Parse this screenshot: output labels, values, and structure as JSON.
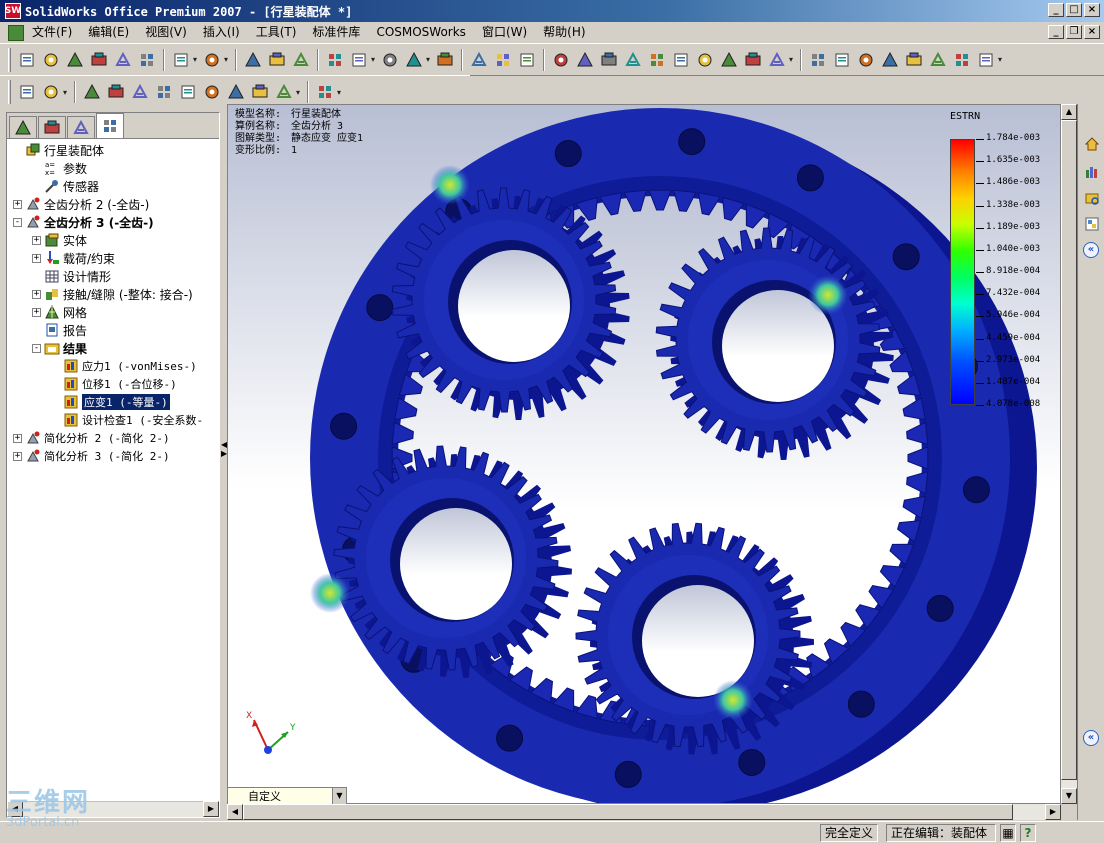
{
  "window": {
    "title": "SolidWorks Office Premium 2007 - [行星装配体 *]",
    "app_icon_text": "SW",
    "controls": {
      "minimize": "_",
      "maximize": "□",
      "close": "×",
      "restore": "❐"
    }
  },
  "menubar": {
    "items": [
      "文件(F)",
      "编辑(E)",
      "视图(V)",
      "插入(I)",
      "工具(T)",
      "标准件库",
      "COSMOSWorks",
      "窗口(W)",
      "帮助(H)"
    ]
  },
  "toolbar1": {
    "icons": [
      "new-icon",
      "open-icon",
      "save-icon",
      "print-preview-icon",
      "options-icon",
      "print-icon",
      "undo-icon",
      "redo-icon",
      "select-icon",
      "smart-select-icon",
      "traffic-light-icon",
      "grid-icon",
      "sketch-icon",
      "assembly-icon",
      "box-icon",
      "help-icon",
      "section-icon",
      "measure-icon",
      "target-icon",
      "mirror-icon",
      "zoom-to-fit-icon",
      "zoom-area-icon",
      "zoom-in-out-icon",
      "zoom-selection-icon",
      "zoom-icon",
      "rotate-icon",
      "pan-icon",
      "roll-icon",
      "view-orientation-icon",
      "wireframe-icon",
      "hidden-lines-icon",
      "hidden-removed-icon",
      "shaded-edges-icon",
      "shaded-icon",
      "shadows-icon",
      "perspective-icon",
      "realview-icon"
    ]
  },
  "toolbar2": {
    "icons": [
      "study-icon",
      "mesh-icon",
      "run-icon",
      "results-icon",
      "plot-icon",
      "clip-icon",
      "probe-icon",
      "animate-icon",
      "design-check-icon",
      "report-icon",
      "wizard-icon",
      "settings-icon"
    ]
  },
  "left_tabs": [
    "feature-manager-tab",
    "property-manager-tab",
    "configuration-manager-tab",
    "cosmos-manager-tab"
  ],
  "tree": [
    {
      "label": "行星装配体",
      "indent": 0,
      "expander": "",
      "icon": "assembly-icon",
      "bold": false,
      "mono": false
    },
    {
      "label": "参数",
      "indent": 1,
      "expander": "",
      "icon": "parameters-icon",
      "bold": false,
      "mono": false
    },
    {
      "label": "传感器",
      "indent": 1,
      "expander": "",
      "icon": "sensor-icon",
      "bold": false,
      "mono": false
    },
    {
      "label": "全齿分析 2 (-全齿-)",
      "indent": 0,
      "expander": "+",
      "icon": "study-icon",
      "bold": false,
      "mono": false
    },
    {
      "label": "全齿分析 3 (-全齿-)",
      "indent": 0,
      "expander": "-",
      "icon": "study-icon",
      "bold": true,
      "mono": false
    },
    {
      "label": "实体",
      "indent": 1,
      "expander": "+",
      "icon": "solids-icon",
      "bold": false,
      "mono": false
    },
    {
      "label": "载荷/约束",
      "indent": 1,
      "expander": "+",
      "icon": "load-restraint-icon",
      "bold": false,
      "mono": false
    },
    {
      "label": "设计情形",
      "indent": 1,
      "expander": "",
      "icon": "design-scenario-icon",
      "bold": false,
      "mono": false
    },
    {
      "label": "接触/缝隙 (-整体: 接合-)",
      "indent": 1,
      "expander": "+",
      "icon": "contact-icon",
      "bold": false,
      "mono": false
    },
    {
      "label": "网格",
      "indent": 1,
      "expander": "+",
      "icon": "mesh-icon",
      "bold": false,
      "mono": false
    },
    {
      "label": "报告",
      "indent": 1,
      "expander": "",
      "icon": "report-icon",
      "bold": false,
      "mono": false
    },
    {
      "label": "结果",
      "indent": 1,
      "expander": "-",
      "icon": "results-folder-icon",
      "bold": true,
      "mono": false
    },
    {
      "label": "应力1 (-vonMises-)",
      "indent": 2,
      "expander": "",
      "icon": "plot-icon",
      "bold": false,
      "mono": true
    },
    {
      "label": "位移1 (-合位移-)",
      "indent": 2,
      "expander": "",
      "icon": "plot-icon",
      "bold": false,
      "mono": true
    },
    {
      "label": "应变1 (-等量-)",
      "indent": 2,
      "expander": "",
      "icon": "plot-icon",
      "bold": false,
      "mono": true,
      "selected": true
    },
    {
      "label": "设计检查1 (-安全系数-",
      "indent": 2,
      "expander": "",
      "icon": "plot-icon",
      "bold": false,
      "mono": true
    },
    {
      "label": "简化分析 2 (-简化 2-)",
      "indent": 0,
      "expander": "+",
      "icon": "study-icon",
      "bold": false,
      "mono": true
    },
    {
      "label": "简化分析 3 (-简化 2-)",
      "indent": 0,
      "expander": "+",
      "icon": "study-icon",
      "bold": false,
      "mono": true
    }
  ],
  "plot_info": [
    {
      "key": "模型名称:",
      "value": "行星装配体"
    },
    {
      "key": "算例名称:",
      "value": "全齿分析 3"
    },
    {
      "key": "图解类型:",
      "value": "静态应变 应变1"
    },
    {
      "key": "变形比例:",
      "value": "1"
    }
  ],
  "legend": {
    "title": "ESTRN",
    "values": [
      "1.784e-003",
      "1.635e-003",
      "1.486e-003",
      "1.338e-003",
      "1.189e-003",
      "1.040e-003",
      "8.918e-004",
      "7.432e-004",
      "5.946e-004",
      "4.459e-004",
      "2.973e-004",
      "1.487e-004",
      "4.078e-008"
    ]
  },
  "axes": {
    "x": "X",
    "y": "Y"
  },
  "view_select": {
    "value": "自定义"
  },
  "statusbar": {
    "fully_defined": "完全定义",
    "editing": "正在编辑：装配体",
    "help": "?"
  },
  "watermark": {
    "line1": "三维网",
    "line2": "3dPortal.cn"
  },
  "colors": {
    "model_blue": "#1a2ab0",
    "highlight_strain": "#c8e020",
    "accent": "#0a246a"
  }
}
